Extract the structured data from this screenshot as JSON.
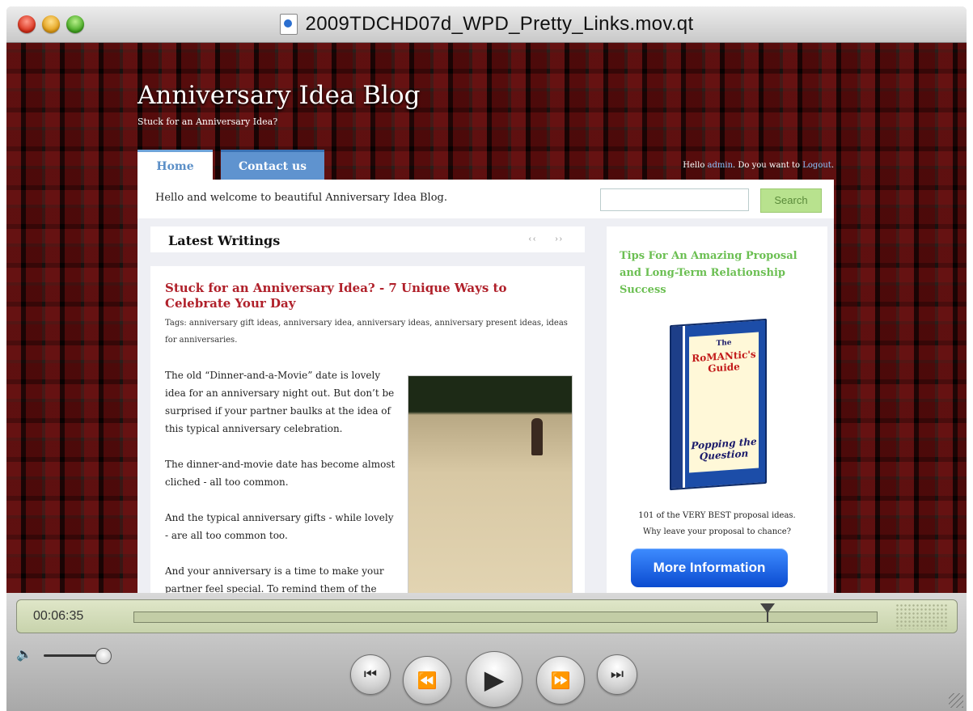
{
  "window": {
    "title": "2009TDCHD07d_WPD_Pretty_Links.mov.qt"
  },
  "blog": {
    "title": "Anniversary Idea Blog",
    "tagline": "Stuck for an Anniversary Idea?",
    "tabs": [
      {
        "label": "Home"
      },
      {
        "label": "Contact us"
      }
    ],
    "greeting_prefix": "Hello ",
    "greeting_user": "admin",
    "greeting_mid": ". Do you want to ",
    "greeting_logout": "Logout",
    "greeting_end": ".",
    "welcome": "Hello and welcome to beautiful Anniversary Idea Blog.",
    "search": {
      "value": "",
      "button": "Search"
    },
    "latest": {
      "title": "Latest Writings",
      "prev": "‹‹",
      "next": "››"
    },
    "post": {
      "title": "Stuck for an Anniversary Idea? - 7 Unique Ways to Celebrate Your Day",
      "tags": "Tags: anniversary gift ideas, anniversary idea, anniversary ideas, anniversary present ideas, ideas for anniversaries.",
      "paragraphs": [
        "The old “Dinner-and-a-Movie” date is lovely idea for an anniversary night out. But don’t be surprised if your partner baulks at the idea of this typical anniversary celebration.",
        "The dinner-and-movie date has become almost cliched - all too common.",
        "And the typical anniversary gifts - while lovely - are all too common too.",
        "And your anniversary is a time to make your partner feel special. To remind them of the"
      ]
    },
    "sidebar": {
      "title": "Tips For An Amazing Proposal and Long-Term Relationship Success",
      "book_line1": "The",
      "book_line2": "RoMANtic's Guide",
      "book_line3": "Popping the Question",
      "caption_line1": "101 of the VERY BEST proposal ideas.",
      "caption_line2": "Why leave your proposal to chance?",
      "button": "More Information"
    }
  },
  "player": {
    "time": "00:06:35",
    "progress": 0.86,
    "volume": 0.9,
    "icons": {
      "volume": "volume-icon",
      "start": "skip-to-start-icon",
      "rewind": "rewind-icon",
      "play": "play-icon",
      "fast_forward": "fast-forward-icon",
      "end": "skip-to-end-icon"
    }
  }
}
